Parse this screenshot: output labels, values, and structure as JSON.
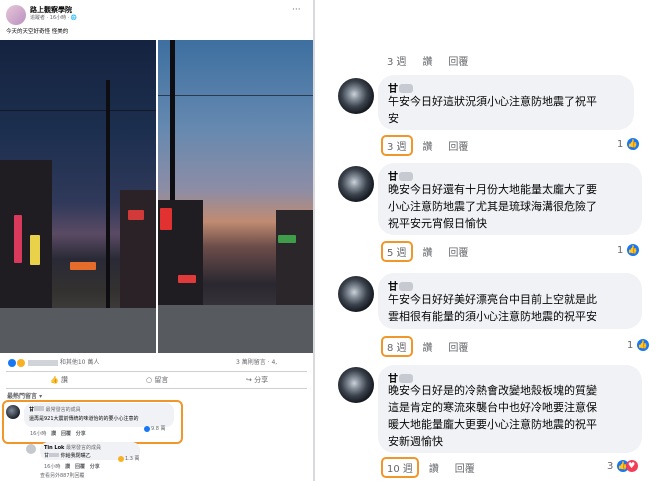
{
  "left_post": {
    "page_name": "路上觀察學院",
    "meta": "追蹤者 · 16小時 · ",
    "more": "···",
    "caption": "今天的天空好奇怪 怪美的",
    "reactions_text": "和其他10 萬人",
    "shares_text": "3 萬則留言 · 4,",
    "actions": {
      "like": "讚",
      "comment": "留言",
      "share": "分享"
    },
    "sort": "最熱門留言 ▾",
    "comment1": {
      "name": "甘",
      "badge": "最常發言的成員",
      "text": "還再是921大震前傳統的味道怡的的要小心注意的",
      "time": "16小時",
      "like": "讚",
      "reply": "回覆",
      "share": "分享",
      "count": "9.8 萬"
    },
    "comment2": {
      "name": "Tin Lok",
      "badge": "最常發言的成員",
      "text": "甘",
      "text2": "你給我閉嘴乙",
      "time": "16小時",
      "like": "讚",
      "reply": "回覆",
      "share": "分享",
      "count": "1.3 萬"
    },
    "more_replies": "查看另外887則回覆"
  },
  "right_comments": {
    "top_meta": {
      "week": "3 週",
      "like": "讚",
      "reply": "回覆"
    },
    "items": [
      {
        "name": "甘",
        "lines": [
          "午安今日好這狀況須小心注意防地震了祝平",
          "安"
        ],
        "week": "3 週",
        "like": "讚",
        "reply": "回覆",
        "count": "1"
      },
      {
        "name": "甘",
        "lines": [
          "晚安今日好還有十月份大地能量太龐大了要",
          "小心注意防地震了尤其是琉球海溝很危險了",
          "祝平安元宵假日愉快"
        ],
        "week": "5 週",
        "like": "讚",
        "reply": "回覆",
        "count": "1"
      },
      {
        "name": "甘",
        "lines": [
          "午安今日好好美好漂亮台中目前上空就是此",
          "雲相很有能量的須小心注意防地震的祝平安"
        ],
        "week": "8 週",
        "like": "讚",
        "reply": "回覆",
        "count": "1"
      },
      {
        "name": "甘",
        "lines": [
          "晚安今日好是的冷熱會改變地殼板塊的質變",
          "這是肯定的寒流來襲台中也好冷吔要注意保",
          "暖大地能量龐大更要小心注意防地震的祝平",
          "安新週愉快"
        ],
        "week": "10 週",
        "like": "讚",
        "reply": "回覆",
        "count": "3"
      }
    ]
  },
  "colors": {
    "highlight": "#f0962a",
    "like_blue": "#1877f2",
    "bubble": "#f0f2f5",
    "text_grey": "#65676b"
  },
  "icons": [
    "more-icon",
    "like-reaction-icon",
    "love-reaction-icon",
    "thumb-icon",
    "comment-icon",
    "share-icon",
    "globe-icon"
  ]
}
